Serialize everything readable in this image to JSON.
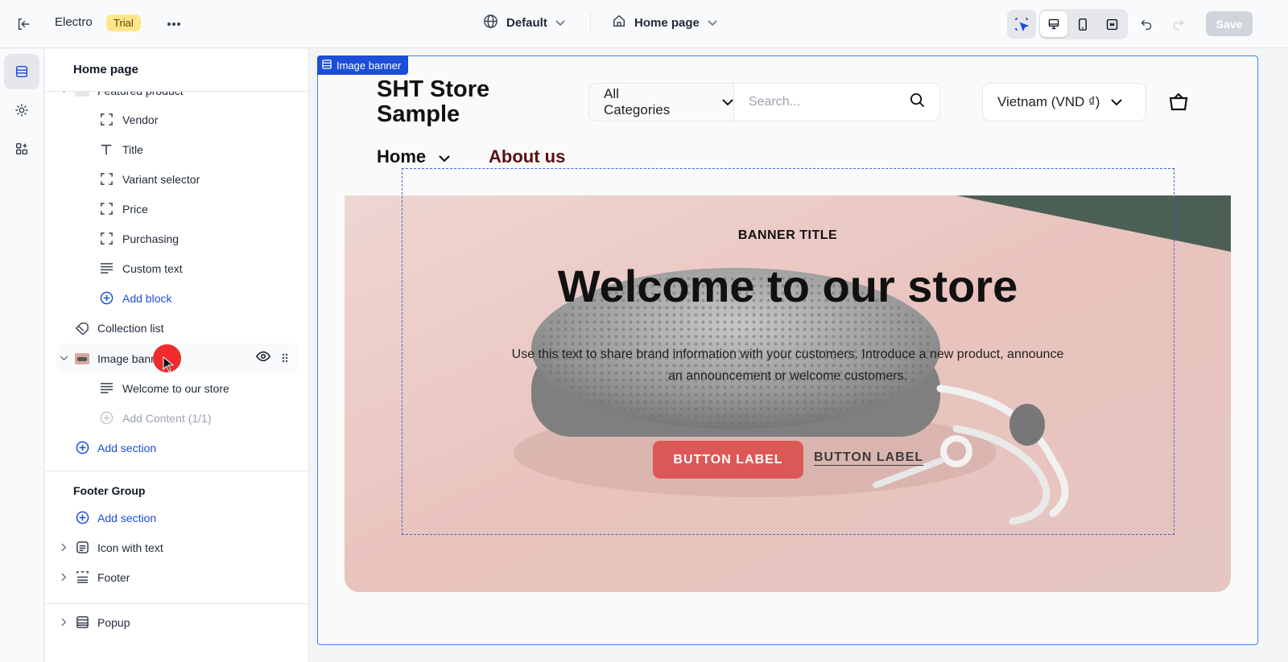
{
  "topbar": {
    "store_name": "Electro",
    "trial_badge": "Trial",
    "theme": "Default",
    "page": "Home page",
    "save_label": "Save"
  },
  "sidebar": {
    "title": "Home page",
    "partial_item": "Featured product",
    "blocks": [
      {
        "icon": "dashed-square-icon",
        "label": "Vendor"
      },
      {
        "icon": "text-icon",
        "label": "Title"
      },
      {
        "icon": "dashed-square-icon",
        "label": "Variant selector"
      },
      {
        "icon": "dashed-square-icon",
        "label": "Price"
      },
      {
        "icon": "dashed-square-icon",
        "label": "Purchasing"
      },
      {
        "icon": "lines-icon",
        "label": "Custom text"
      }
    ],
    "add_block": "Add block",
    "collection_list": "Collection list",
    "image_banner": "Image banner",
    "banner_children": {
      "welcome": "Welcome to our store",
      "add_content": "Add Content (1/1)"
    },
    "add_section": "Add section",
    "footer_group": {
      "title": "Footer Group",
      "add_section": "Add section",
      "items": [
        {
          "icon": "text-box-icon",
          "label": "Icon with text"
        },
        {
          "icon": "layout-icon",
          "label": "Footer"
        }
      ]
    },
    "popup": "Popup"
  },
  "canvas": {
    "selection_tag": "Image banner",
    "store_logo": "SHT Store Sample",
    "category_select": "All Categories",
    "search_placeholder": "Search...",
    "currency": "Vietnam (VND ₫)",
    "nav": {
      "home": "Home",
      "about": "About us"
    },
    "banner": {
      "subtitle": "BANNER TITLE",
      "heading": "Welcome to our store",
      "text": "Use this text to share brand information with your customers. Introduce a new product, announce an announcement or welcome customers.",
      "button1": "BUTTON LABEL",
      "button2": "BUTTON LABEL"
    }
  },
  "colors": {
    "accent": "#1d4ed8",
    "trial_bg": "#fde68a",
    "about_link": "#5a1010",
    "button_primary": "#dc3535"
  }
}
